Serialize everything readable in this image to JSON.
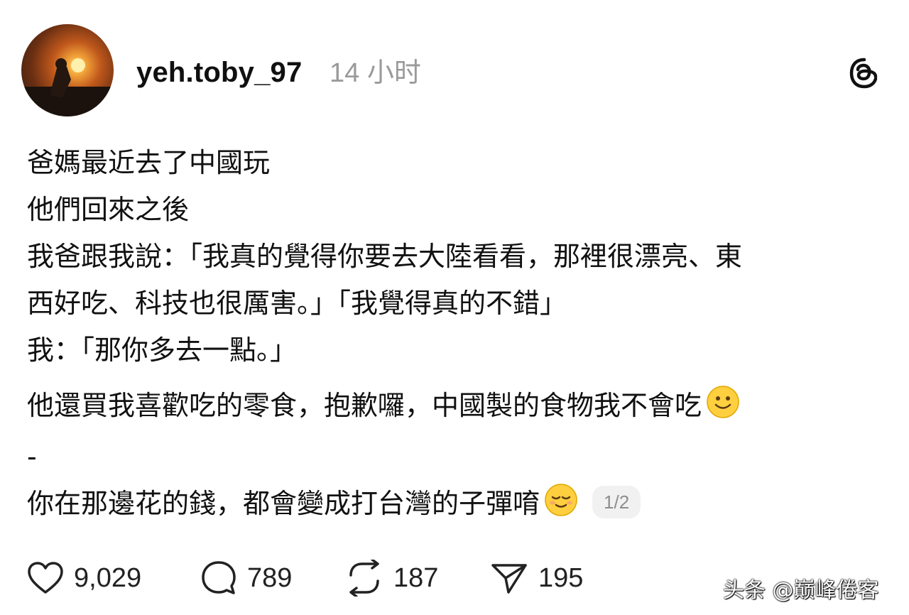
{
  "post": {
    "username": "yeh.toby_97",
    "time": "14 小时",
    "body": {
      "line1": "爸媽最近去了中國玩",
      "line2": "他們回來之後",
      "line3": "我爸跟我說：「我真的覺得你要去大陸看看，那裡很漂亮、東",
      "line4": "西好吃、科技也很厲害。」「我覺得真的不錯」",
      "line5": "我：「那你多去一點。」",
      "line6": "他還買我喜歡吃的零食，抱歉囉，中國製的食物我不會吃",
      "line7": "-",
      "line8": "你在那邊花的錢，都會變成打台灣的子彈唷"
    },
    "page_indicator": "1/2"
  },
  "actions": {
    "likes": "9,029",
    "comments": "789",
    "reposts": "187",
    "shares": "195"
  },
  "watermark": "头条 @巅峰倦客",
  "icons": {
    "logo": "threads-logo-icon",
    "like": "heart-icon",
    "comment": "comment-bubble-icon",
    "repost": "repost-icon",
    "share": "paper-plane-icon"
  },
  "colors": {
    "text": "#111111",
    "muted": "#9a9a9a",
    "badge_bg": "#f1f1f1"
  }
}
